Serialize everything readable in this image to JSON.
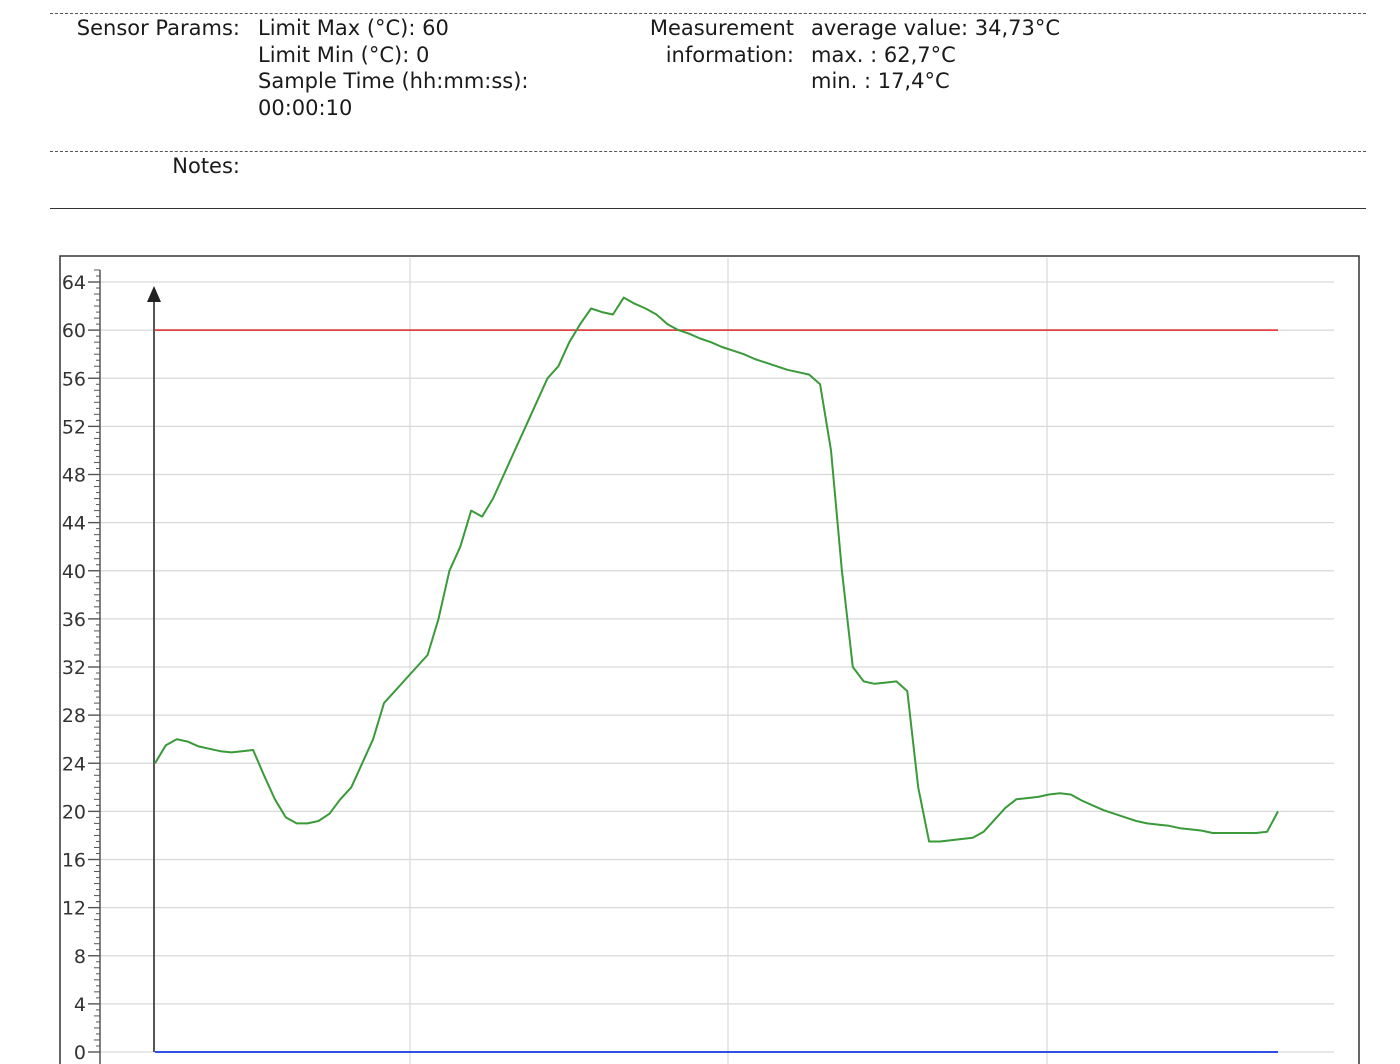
{
  "sensor_params": {
    "label": "Sensor Params:",
    "lines": [
      "Limit Max (°C): 60",
      "Limit Min (°C): 0",
      "Sample Time (hh:mm:ss):",
      "00:00:10"
    ]
  },
  "measurement": {
    "label_line1": "Measurement",
    "label_line2": "information:",
    "lines": [
      "average value: 34,73°C",
      "max. : 62,7°C",
      "min. : 17,4°C"
    ]
  },
  "notes": {
    "label": "Notes:",
    "value": ""
  },
  "colors": {
    "series": "#3a9a3a",
    "limit_max": "#e04040",
    "limit_min": "#3050e0",
    "grid": "#d9d9d9",
    "axis": "#555555"
  },
  "chart_data": {
    "type": "line",
    "ylim": [
      0,
      66
    ],
    "yticks": [
      0,
      4,
      8,
      12,
      16,
      20,
      24,
      28,
      32,
      36,
      40,
      44,
      48,
      52,
      56,
      60,
      64
    ],
    "grid": true,
    "limit_max": 60,
    "limit_min": 0,
    "series": [
      {
        "values": [
          24,
          25.5,
          26,
          25.8,
          25.4,
          25.2,
          25.0,
          24.9,
          25.0,
          25.1,
          23,
          21,
          19.5,
          19,
          19,
          19.2,
          19.8,
          21,
          22,
          24,
          26,
          29,
          30,
          31,
          32,
          33,
          36,
          40,
          42,
          45,
          44.5,
          46,
          48,
          50,
          52,
          54,
          56,
          57,
          59,
          60.5,
          61.8,
          61.5,
          61.3,
          62.7,
          62.2,
          61.8,
          61.3,
          60.5,
          60,
          59.7,
          59.3,
          59,
          58.6,
          58.3,
          58.0,
          57.6,
          57.3,
          57.0,
          56.7,
          56.5,
          56.3,
          55.5,
          50,
          40,
          32,
          30.8,
          30.6,
          30.7,
          30.8,
          30,
          22,
          17.5,
          17.5,
          17.6,
          17.7,
          17.8,
          18.3,
          19.3,
          20.3,
          21.0,
          21.1,
          21.2,
          21.4,
          21.5,
          21.4,
          20.9,
          20.5,
          20.1,
          19.8,
          19.5,
          19.2,
          19.0,
          18.9,
          18.8,
          18.6,
          18.5,
          18.4,
          18.2,
          18.2,
          18.2,
          18.2,
          18.2,
          18.3,
          20.0
        ]
      }
    ]
  }
}
